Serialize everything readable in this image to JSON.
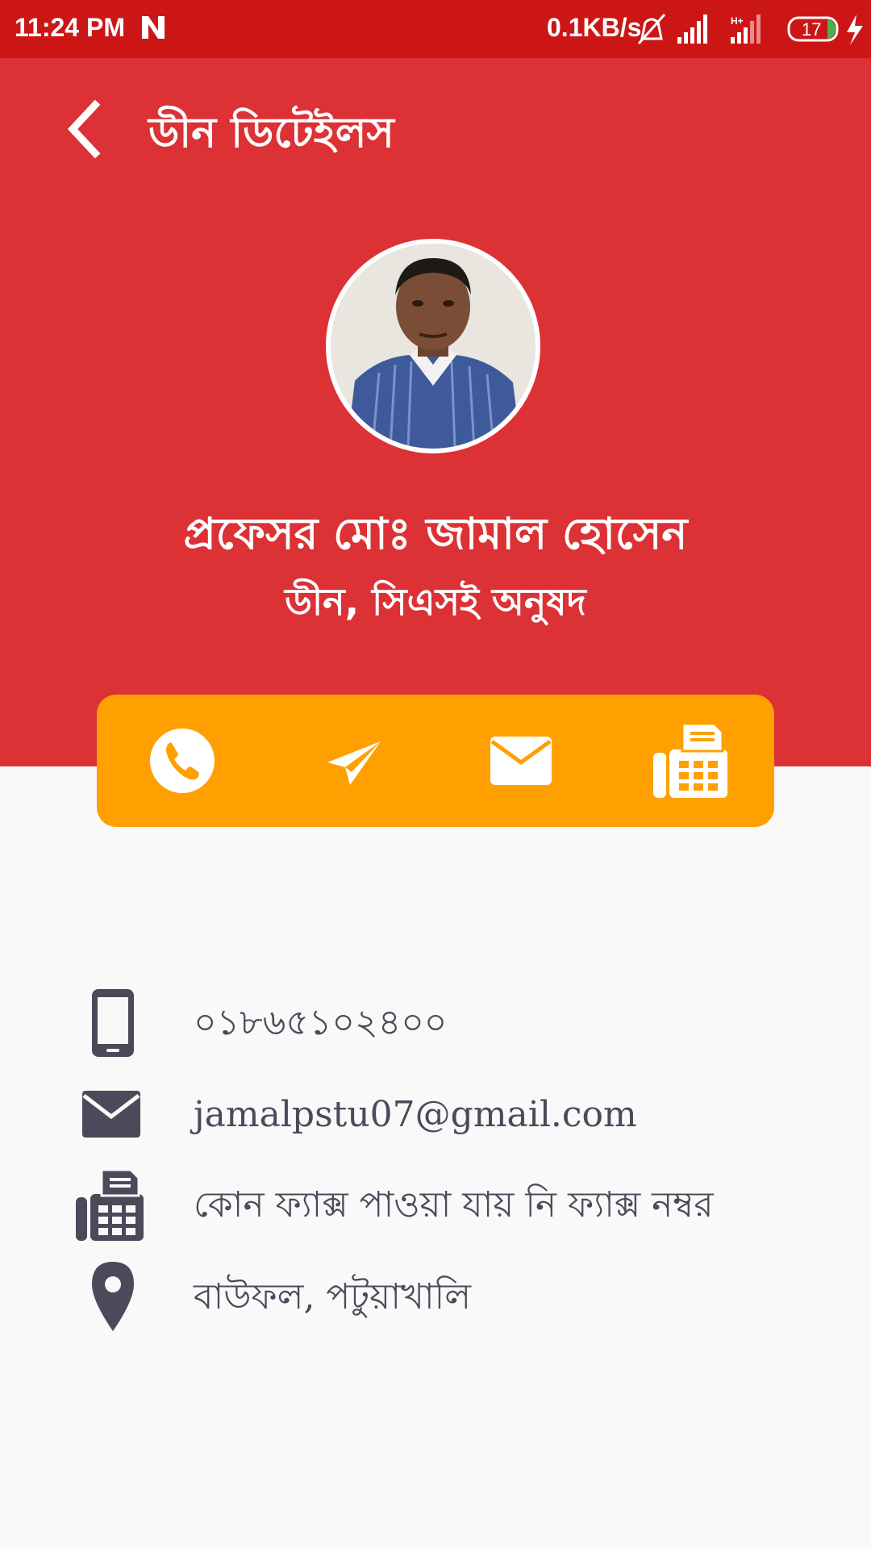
{
  "status_bar": {
    "time": "11:24 PM",
    "network_speed": "0.1KB/s",
    "battery_level": "17",
    "icons": [
      "n-notification-icon",
      "vibrate-off-icon",
      "signal-icon",
      "hplus-signal-icon",
      "battery-icon",
      "charging-icon"
    ]
  },
  "header": {
    "title": "ডীন ডিটেইলস",
    "background_color": "#dc3135"
  },
  "profile": {
    "name": "প্রফেসর মোঃ জামাল হোসেন",
    "role": "ডীন, সিএসই অনুষদ"
  },
  "actions": {
    "background_color": "#ffa000",
    "items": [
      "call",
      "message",
      "email",
      "fax"
    ]
  },
  "info": {
    "phone": "০১৮৬৫১০২৪০০",
    "email": "jamalpstu07@gmail.com",
    "fax": "কোন ফ্যাক্স পাওয়া যায় নি ফ্যাক্স নম্বর",
    "location": "বাউফল, পটুয়াখালি"
  },
  "colors": {
    "status_bar": "#cc1616",
    "icon_gray": "#4a4a5a",
    "page_background": "#f9f9f9"
  }
}
